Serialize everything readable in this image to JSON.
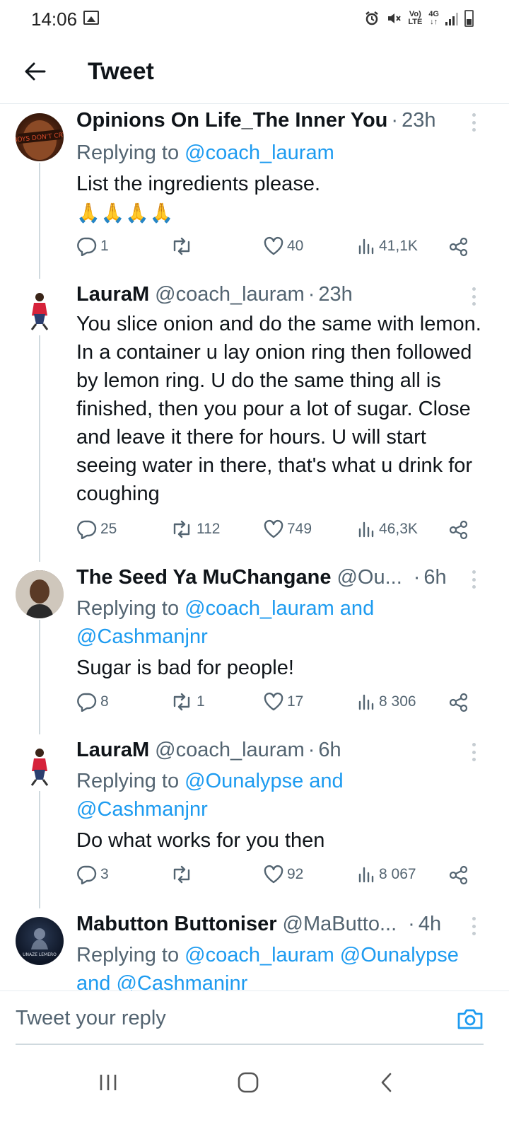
{
  "status_bar": {
    "time": "14:06",
    "volte": "Vo)",
    "lte": "LTE",
    "network": "4G"
  },
  "header": {
    "title": "Tweet"
  },
  "tweets": [
    {
      "name": "Opinions On Life_The Inner You",
      "handle": "",
      "time": "23h",
      "replying_prefix": "Replying to ",
      "replying_to": "@coach_lauram",
      "body": "List the ingredients please.",
      "emoji": "🙏🙏🙏🙏",
      "avatar_text": "BOYS DON'T CRY",
      "replies": "1",
      "retweets": "",
      "likes": "40",
      "views": "41,1K"
    },
    {
      "name": "LauraM",
      "handle": "@coach_lauram",
      "time": "23h",
      "body": "You slice onion and do the same with lemon. In a container u lay onion ring then followed by lemon ring. U do the same thing all is finished, then you pour a lot of sugar. Close and leave it there for hours. U will start seeing water in there, that's what u drink for coughing",
      "replies": "25",
      "retweets": "112",
      "likes": "749",
      "views": "46,3K"
    },
    {
      "name": "The Seed Ya MuChangane",
      "handle": "@Ou...",
      "time": "6h",
      "replying_prefix": "Replying to ",
      "replying_to": "@coach_lauram and @Cashmanjnr",
      "body": "Sugar is bad for people!",
      "replies": "8",
      "retweets": "1",
      "likes": "17",
      "views": "8 306"
    },
    {
      "name": "LauraM",
      "handle": "@coach_lauram",
      "time": "6h",
      "replying_prefix": "Replying to ",
      "replying_to": "@Ounalypse and @Cashmanjnr",
      "body": "Do what works for you then",
      "replies": "3",
      "retweets": "",
      "likes": "92",
      "views": "8 067"
    },
    {
      "name": "Mabutton Buttoniser",
      "handle": "@MaButto...",
      "time": "4h",
      "replying_prefix": "Replying to ",
      "replying_to": "@coach_lauram @Ounalypse and @Cashmanjnr",
      "avatar_text": "UNAZE LEMERO"
    }
  ],
  "reply_bar": {
    "placeholder": "Tweet your reply"
  },
  "colors": {
    "accent": "#1d9bf0",
    "text": "#0f1419",
    "muted": "#536471",
    "divider": "#cfd9de"
  },
  "icons": [
    "back-arrow-icon",
    "reply-icon",
    "retweet-icon",
    "like-icon",
    "views-icon",
    "share-icon",
    "more-icon",
    "camera-icon",
    "recents-nav-icon",
    "home-nav-icon",
    "back-nav-icon"
  ]
}
